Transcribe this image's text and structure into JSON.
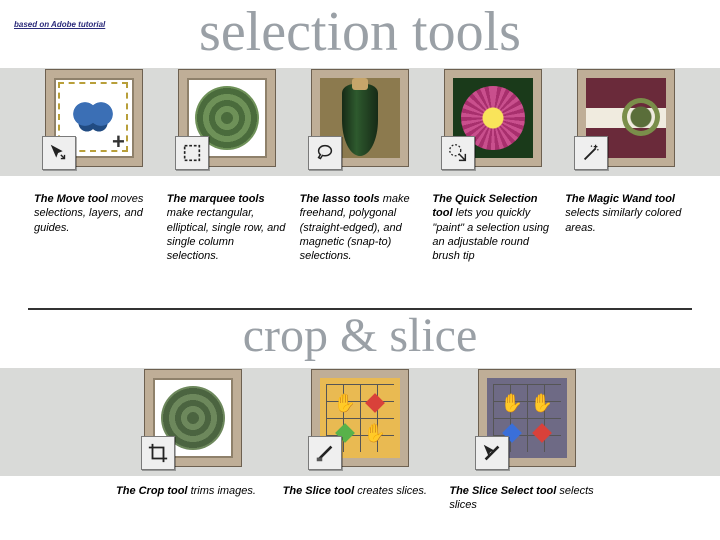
{
  "attribution": "based on Adobe tutorial",
  "heading1": "selection tools",
  "heading2": "crop & slice",
  "selection": [
    {
      "name": "The Move tool",
      "body": "moves selections, layers, and guides.",
      "icon": "move-icon"
    },
    {
      "name": "The marquee tools",
      "body": "make rectangular, elliptical, single row, and single column selections.",
      "icon": "marquee-icon"
    },
    {
      "name": "The lasso tools",
      "body": "make freehand, polygonal (straight-edged), and magnetic (snap-to) selections.",
      "icon": "lasso-icon"
    },
    {
      "name": "The Quick Selection tool",
      "body": "lets you quickly \"paint\" a selection using an adjustable round brush tip",
      "icon": "quick-select-icon"
    },
    {
      "name": "The Magic Wand tool",
      "body": "selects similarly colored areas.",
      "icon": "wand-icon"
    }
  ],
  "cropslice": [
    {
      "name": "The Crop tool",
      "body": "trims images.",
      "icon": "crop-icon"
    },
    {
      "name": "The Slice tool",
      "body": "creates slices.",
      "icon": "slice-icon"
    },
    {
      "name": "The Slice Select tool",
      "body": "selects slices",
      "icon": "slice-select-icon"
    }
  ]
}
